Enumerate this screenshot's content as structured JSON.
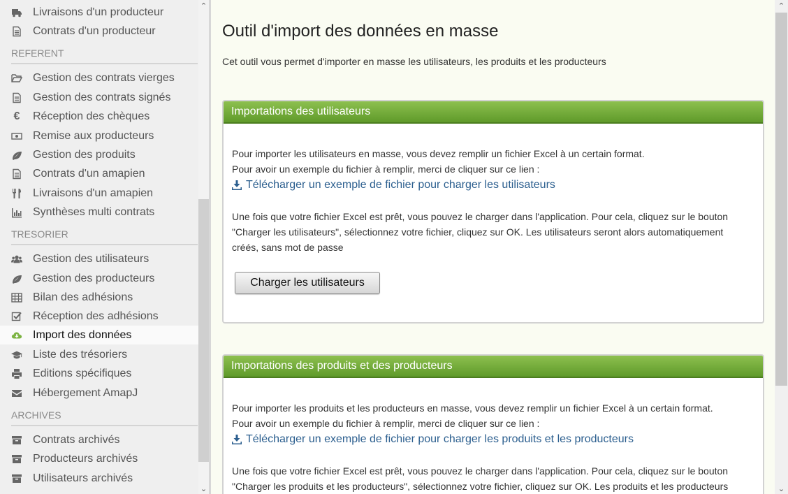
{
  "sidebar": {
    "items": [
      {
        "label": "Livraisons d'un producteur",
        "icon": "truck-icon"
      },
      {
        "label": "Contrats d'un producteur",
        "icon": "file-icon"
      },
      {
        "label": "Gestion des contrats vierges",
        "icon": "folder-open-icon"
      },
      {
        "label": "Gestion des contrats signés",
        "icon": "file-icon"
      },
      {
        "label": "Réception des chèques",
        "icon": "euro-icon"
      },
      {
        "label": "Remise aux producteurs",
        "icon": "money-icon"
      },
      {
        "label": "Gestion des produits",
        "icon": "leaf-icon"
      },
      {
        "label": "Contrats d'un amapien",
        "icon": "file-icon"
      },
      {
        "label": "Livraisons d'un amapien",
        "icon": "cutlery-icon"
      },
      {
        "label": "Synthèses multi contrats",
        "icon": "bar-chart-icon"
      },
      {
        "label": "Gestion des utilisateurs",
        "icon": "users-icon"
      },
      {
        "label": "Gestion des producteurs",
        "icon": "leaf-icon"
      },
      {
        "label": "Bilan des adhésions",
        "icon": "table-icon"
      },
      {
        "label": "Réception des adhésions",
        "icon": "check-square-icon"
      },
      {
        "label": "Import des données",
        "icon": "cloud-download-icon"
      },
      {
        "label": "Liste des trésoriers",
        "icon": "graduation-cap-icon"
      },
      {
        "label": "Editions spécifiques",
        "icon": "print-icon"
      },
      {
        "label": "Hébergement AmapJ",
        "icon": "envelope-icon"
      },
      {
        "label": "Contrats archivés",
        "icon": "archive-icon"
      },
      {
        "label": "Producteurs archivés",
        "icon": "archive-icon"
      },
      {
        "label": "Utilisateurs archivés",
        "icon": "archive-icon"
      }
    ],
    "sections": [
      "REFERENT",
      "TRESORIER",
      "ARCHIVES"
    ],
    "active": "Import des données"
  },
  "main": {
    "title": "Outil d'import des données en masse",
    "intro": "Cet outil vous permet d'importer en masse les utilisateurs, les produits et les producteurs",
    "panels": [
      {
        "title": "Importations des utilisateurs",
        "p1_line1": "Pour importer les utilisateurs en masse, vous devez remplir un fichier Excel à un certain format.",
        "p1_line2": "Pour avoir un exemple du fichier à remplir, merci de cliquer sur ce lien :",
        "link": "Télécharger un exemple de fichier pour charger les utilisateurs",
        "p2": "Une fois que votre fichier Excel est prêt, vous pouvez le charger dans l'application. Pour cela, cliquez sur le bouton \"Charger les utilisateurs\", sélectionnez votre fichier, cliquez sur OK. Les utilisateurs seront alors automatiquement créés, sans mot de passe",
        "button": "Charger les utilisateurs"
      },
      {
        "title": "Importations des produits et des producteurs",
        "p1_line1": "Pour importer les produits et les producteurs en masse, vous devez remplir un fichier Excel à un certain format.",
        "p1_line2": "Pour avoir un exemple du fichier à remplir, merci de cliquer sur ce lien :",
        "link": "Télécharger un exemple de fichier pour charger les produits et les producteurs",
        "p2": "Une fois que votre fichier Excel est prêt, vous pouvez le charger dans l'application. Pour cela, cliquez sur le bouton \"Charger les produits et les producteurs\", sélectionnez votre fichier, cliquez sur OK. Les produits et les producteurs"
      }
    ]
  },
  "colors": {
    "header_green": "#6fa834",
    "link_blue": "#2c5f8f",
    "active_icon_green": "#7cb342"
  }
}
